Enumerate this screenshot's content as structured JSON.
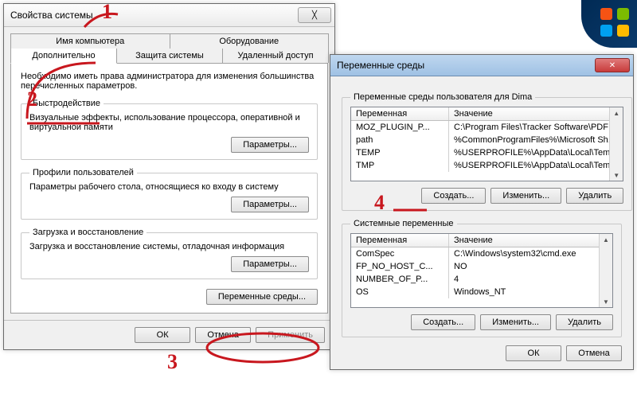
{
  "sysprops": {
    "title": "Свойства системы",
    "tabs_row1": [
      "Имя компьютера",
      "Оборудование"
    ],
    "tabs_row2": [
      "Дополнительно",
      "Защита системы",
      "Удаленный доступ"
    ],
    "intro": "Необходимо иметь права администратора для изменения большинства перечисленных параметров.",
    "perf_legend": "Быстродействие",
    "perf_text": "Визуальные эффекты, использование процессора, оперативной и виртуальной памяти",
    "profiles_legend": "Профили пользователей",
    "profiles_text": "Параметры рабочего стола, относящиеся ко входу в систему",
    "boot_legend": "Загрузка и восстановление",
    "boot_text": "Загрузка и восстановление системы, отладочная информация",
    "params_btn": "Параметры...",
    "envvars_btn": "Переменные среды...",
    "ok": "ОК",
    "cancel": "Отмена",
    "apply": "Применить"
  },
  "envdlg": {
    "title": "Переменные среды",
    "user_legend": "Переменные среды пользователя для Dima",
    "sys_legend": "Системные переменные",
    "col_var": "Переменная",
    "col_val": "Значение",
    "user_rows": [
      {
        "name": "MOZ_PLUGIN_P...",
        "value": "C:\\Program Files\\Tracker Software\\PDF ..."
      },
      {
        "name": "path",
        "value": "%CommonProgramFiles%\\Microsoft Sh..."
      },
      {
        "name": "TEMP",
        "value": "%USERPROFILE%\\AppData\\Local\\Temp"
      },
      {
        "name": "TMP",
        "value": "%USERPROFILE%\\AppData\\Local\\Temp"
      }
    ],
    "sys_rows": [
      {
        "name": "ComSpec",
        "value": "C:\\Windows\\system32\\cmd.exe"
      },
      {
        "name": "FP_NO_HOST_C...",
        "value": "NO"
      },
      {
        "name": "NUMBER_OF_P...",
        "value": "4"
      },
      {
        "name": "OS",
        "value": "Windows_NT"
      }
    ],
    "create": "Создать...",
    "edit": "Изменить...",
    "delete": "Удалить",
    "ok": "ОК",
    "cancel": "Отмена"
  },
  "annotations": {
    "n1": "1",
    "n2": "2",
    "n3": "3",
    "n4": "4"
  }
}
